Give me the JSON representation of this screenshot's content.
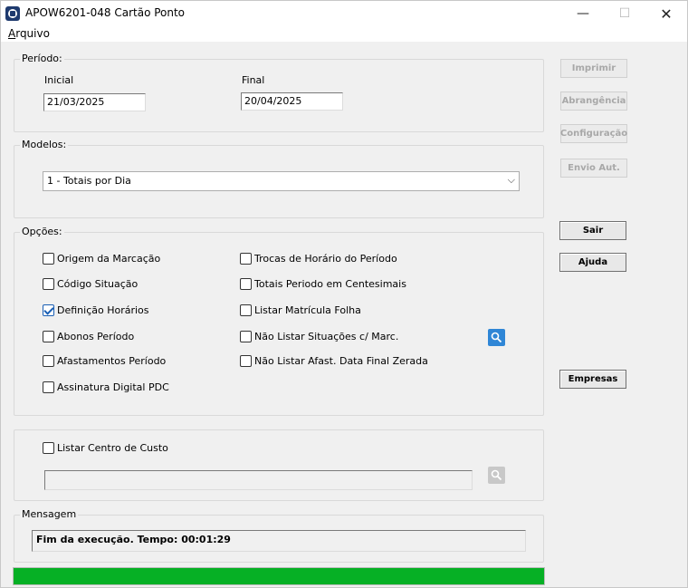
{
  "window": {
    "title": "APOW6201-048 Cartão Ponto",
    "minimize_glyph": "—",
    "maximize_glyph": "☐",
    "close_glyph": "✕"
  },
  "menu": {
    "items": [
      {
        "accel": "A",
        "rest": "rquivo"
      }
    ]
  },
  "periodo": {
    "group_label": "Período:",
    "inicial_label": "Inicial",
    "inicial_value": "21/03/2025",
    "final_label": "Final",
    "final_value": "20/04/2025"
  },
  "modelos": {
    "group_label": "Modelos:",
    "selected": "1 - Totais por Dia",
    "chevron": "⌵"
  },
  "opcoes": {
    "group_label": "Opções:",
    "left": [
      {
        "label": "Origem da Marcação",
        "checked": false
      },
      {
        "label": "Código Situação",
        "checked": false
      },
      {
        "label": "Definição Horários",
        "checked": true
      },
      {
        "label": "Abonos Período",
        "checked": false
      },
      {
        "label": "Afastamentos Período",
        "checked": false
      },
      {
        "label": "Assinatura Digital PDC",
        "checked": false
      }
    ],
    "right": [
      {
        "label": "Trocas de Horário do Período",
        "checked": false
      },
      {
        "label": "Totais Periodo em Centesimais",
        "checked": false
      },
      {
        "label": "Listar Matrícula Folha",
        "checked": false
      },
      {
        "label": "Não Listar Situações c/ Marc.",
        "checked": false
      },
      {
        "label": "Não Listar Afast. Data Final Zerada",
        "checked": false
      }
    ]
  },
  "centro_custo": {
    "label": "Listar Centro de Custo",
    "checked": false,
    "value": ""
  },
  "mensagem": {
    "group_label": "Mensagem",
    "text": "Fim da execução. Tempo: 00:01:29"
  },
  "progress": {
    "fraction": 1.0,
    "color": "#06b025"
  },
  "buttons": {
    "imprimir": "Imprimir",
    "abrangencia": "Abrangência",
    "configuracao": "Configuração",
    "envio": "Envio Aut.",
    "sair": "Sair",
    "ajuda": "Ajuda",
    "empresas": "Empresas"
  },
  "icons": {
    "search_active": "search-icon",
    "search_inactive": "search-icon"
  }
}
